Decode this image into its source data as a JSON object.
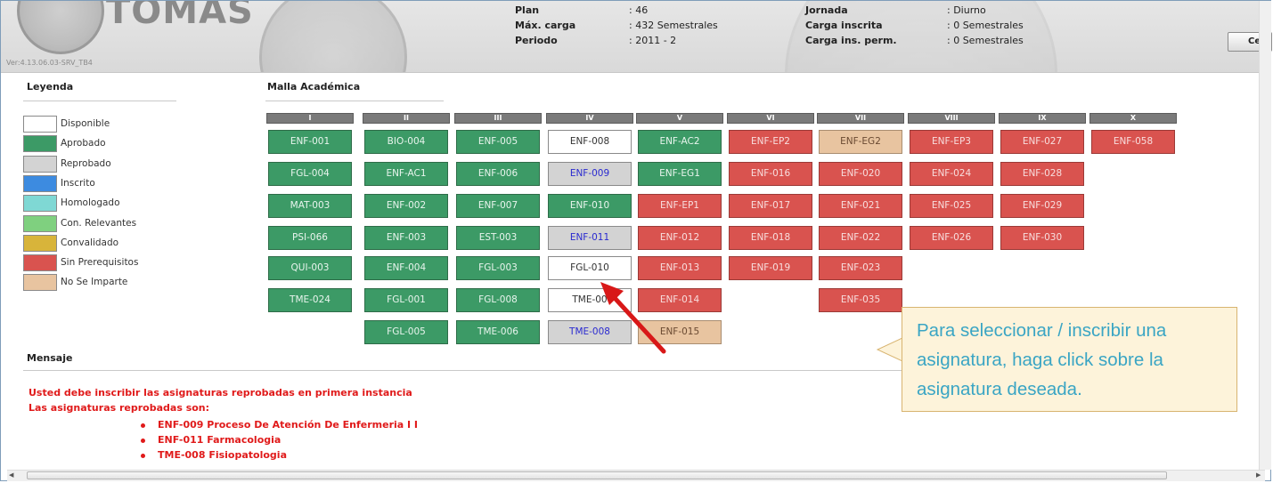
{
  "header": {
    "logo_text": "TOMÁS",
    "version": "Ver:4.13.06.03-SRV_TB4",
    "fields": [
      {
        "label": "Plan",
        "value": ": 46"
      },
      {
        "label": "Máx. carga",
        "value": ": 432 Semestrales"
      },
      {
        "label": "Periodo",
        "value": ": 2011 - 2"
      },
      {
        "label": "Jornada",
        "value": ": Diurno"
      },
      {
        "label": "Carga inscrita",
        "value": ": 0 Semestrales"
      },
      {
        "label": "Carga ins. perm.",
        "value": ": 0 Semestrales"
      }
    ],
    "button_label": "Ce"
  },
  "legend": {
    "title": "Leyenda",
    "items": [
      {
        "label": "Disponible",
        "color": "#ffffff"
      },
      {
        "label": "Aprobado",
        "color": "#3c9a66"
      },
      {
        "label": "Reprobado",
        "color": "#d3d3d3"
      },
      {
        "label": "Inscrito",
        "color": "#3d8be0"
      },
      {
        "label": "Homologado",
        "color": "#7fd8d4"
      },
      {
        "label": "Con. Relevantes",
        "color": "#7fd07f"
      },
      {
        "label": "Convalidado",
        "color": "#d8b43a"
      },
      {
        "label": "Sin Prerequisitos",
        "color": "#d9534f"
      },
      {
        "label": "No Se Imparte",
        "color": "#e8c4a0"
      }
    ]
  },
  "malla": {
    "title": "Malla Académica",
    "columns": [
      {
        "header": "I",
        "courses": [
          {
            "code": "ENF-001",
            "status": "apr"
          },
          {
            "code": "FGL-004",
            "status": "apr"
          },
          {
            "code": "MAT-003",
            "status": "apr"
          },
          {
            "code": "PSI-066",
            "status": "apr"
          },
          {
            "code": "QUI-003",
            "status": "apr"
          },
          {
            "code": "TME-024",
            "status": "apr"
          }
        ]
      },
      {
        "header": "II",
        "courses": [
          {
            "code": "BIO-004",
            "status": "apr"
          },
          {
            "code": "ENF-AC1",
            "status": "apr"
          },
          {
            "code": "ENF-002",
            "status": "apr"
          },
          {
            "code": "ENF-003",
            "status": "apr"
          },
          {
            "code": "ENF-004",
            "status": "apr"
          },
          {
            "code": "FGL-001",
            "status": "apr"
          },
          {
            "code": "FGL-005",
            "status": "apr"
          }
        ]
      },
      {
        "header": "III",
        "courses": [
          {
            "code": "ENF-005",
            "status": "apr"
          },
          {
            "code": "ENF-006",
            "status": "apr"
          },
          {
            "code": "ENF-007",
            "status": "apr"
          },
          {
            "code": "EST-003",
            "status": "apr"
          },
          {
            "code": "FGL-003",
            "status": "apr"
          },
          {
            "code": "FGL-008",
            "status": "apr"
          },
          {
            "code": "TME-006",
            "status": "apr"
          }
        ]
      },
      {
        "header": "IV",
        "courses": [
          {
            "code": "ENF-008",
            "status": "disp"
          },
          {
            "code": "ENF-009",
            "status": "rep"
          },
          {
            "code": "ENF-010",
            "status": "apr"
          },
          {
            "code": "ENF-011",
            "status": "rep"
          },
          {
            "code": "FGL-010",
            "status": "disp"
          },
          {
            "code": "TME-00",
            "status": "disp"
          },
          {
            "code": "TME-008",
            "status": "rep"
          }
        ]
      },
      {
        "header": "V",
        "courses": [
          {
            "code": "ENF-AC2",
            "status": "apr"
          },
          {
            "code": "ENF-EG1",
            "status": "apr"
          },
          {
            "code": "ENF-EP1",
            "status": "sin"
          },
          {
            "code": "ENF-012",
            "status": "sin"
          },
          {
            "code": "ENF-013",
            "status": "sin"
          },
          {
            "code": "ENF-014",
            "status": "sin"
          },
          {
            "code": "ENF-015",
            "status": "nosi"
          }
        ]
      },
      {
        "header": "VI",
        "courses": [
          {
            "code": "ENF-EP2",
            "status": "sin"
          },
          {
            "code": "ENF-016",
            "status": "sin"
          },
          {
            "code": "ENF-017",
            "status": "sin"
          },
          {
            "code": "ENF-018",
            "status": "sin"
          },
          {
            "code": "ENF-019",
            "status": "sin"
          }
        ]
      },
      {
        "header": "VII",
        "courses": [
          {
            "code": "ENF-EG2",
            "status": "nosi"
          },
          {
            "code": "ENF-020",
            "status": "sin"
          },
          {
            "code": "ENF-021",
            "status": "sin"
          },
          {
            "code": "ENF-022",
            "status": "sin"
          },
          {
            "code": "ENF-023",
            "status": "sin"
          },
          {
            "code": "ENF-035",
            "status": "sin"
          }
        ]
      },
      {
        "header": "VIII",
        "courses": [
          {
            "code": "ENF-EP3",
            "status": "sin"
          },
          {
            "code": "ENF-024",
            "status": "sin"
          },
          {
            "code": "ENF-025",
            "status": "sin"
          },
          {
            "code": "ENF-026",
            "status": "sin"
          }
        ]
      },
      {
        "header": "IX",
        "courses": [
          {
            "code": "ENF-027",
            "status": "sin"
          },
          {
            "code": "ENF-028",
            "status": "sin"
          },
          {
            "code": "ENF-029",
            "status": "sin"
          },
          {
            "code": "ENF-030",
            "status": "sin"
          }
        ]
      },
      {
        "header": "X",
        "courses": [
          {
            "code": "ENF-058",
            "status": "sin"
          }
        ]
      }
    ]
  },
  "mensaje": {
    "title": "Mensaje",
    "line1": "Usted debe inscribir las asignaturas reprobadas en primera instancia",
    "line2": "Las asignaturas reprobadas son:",
    "items": [
      "ENF-009 Proceso De Atención De Enfermeria I I",
      "ENF-011 Farmacologia",
      "TME-008 Fisiopatologia"
    ]
  },
  "callout": {
    "text": "Para seleccionar / inscribir una asignatura, haga click sobre la asignatura deseada."
  }
}
